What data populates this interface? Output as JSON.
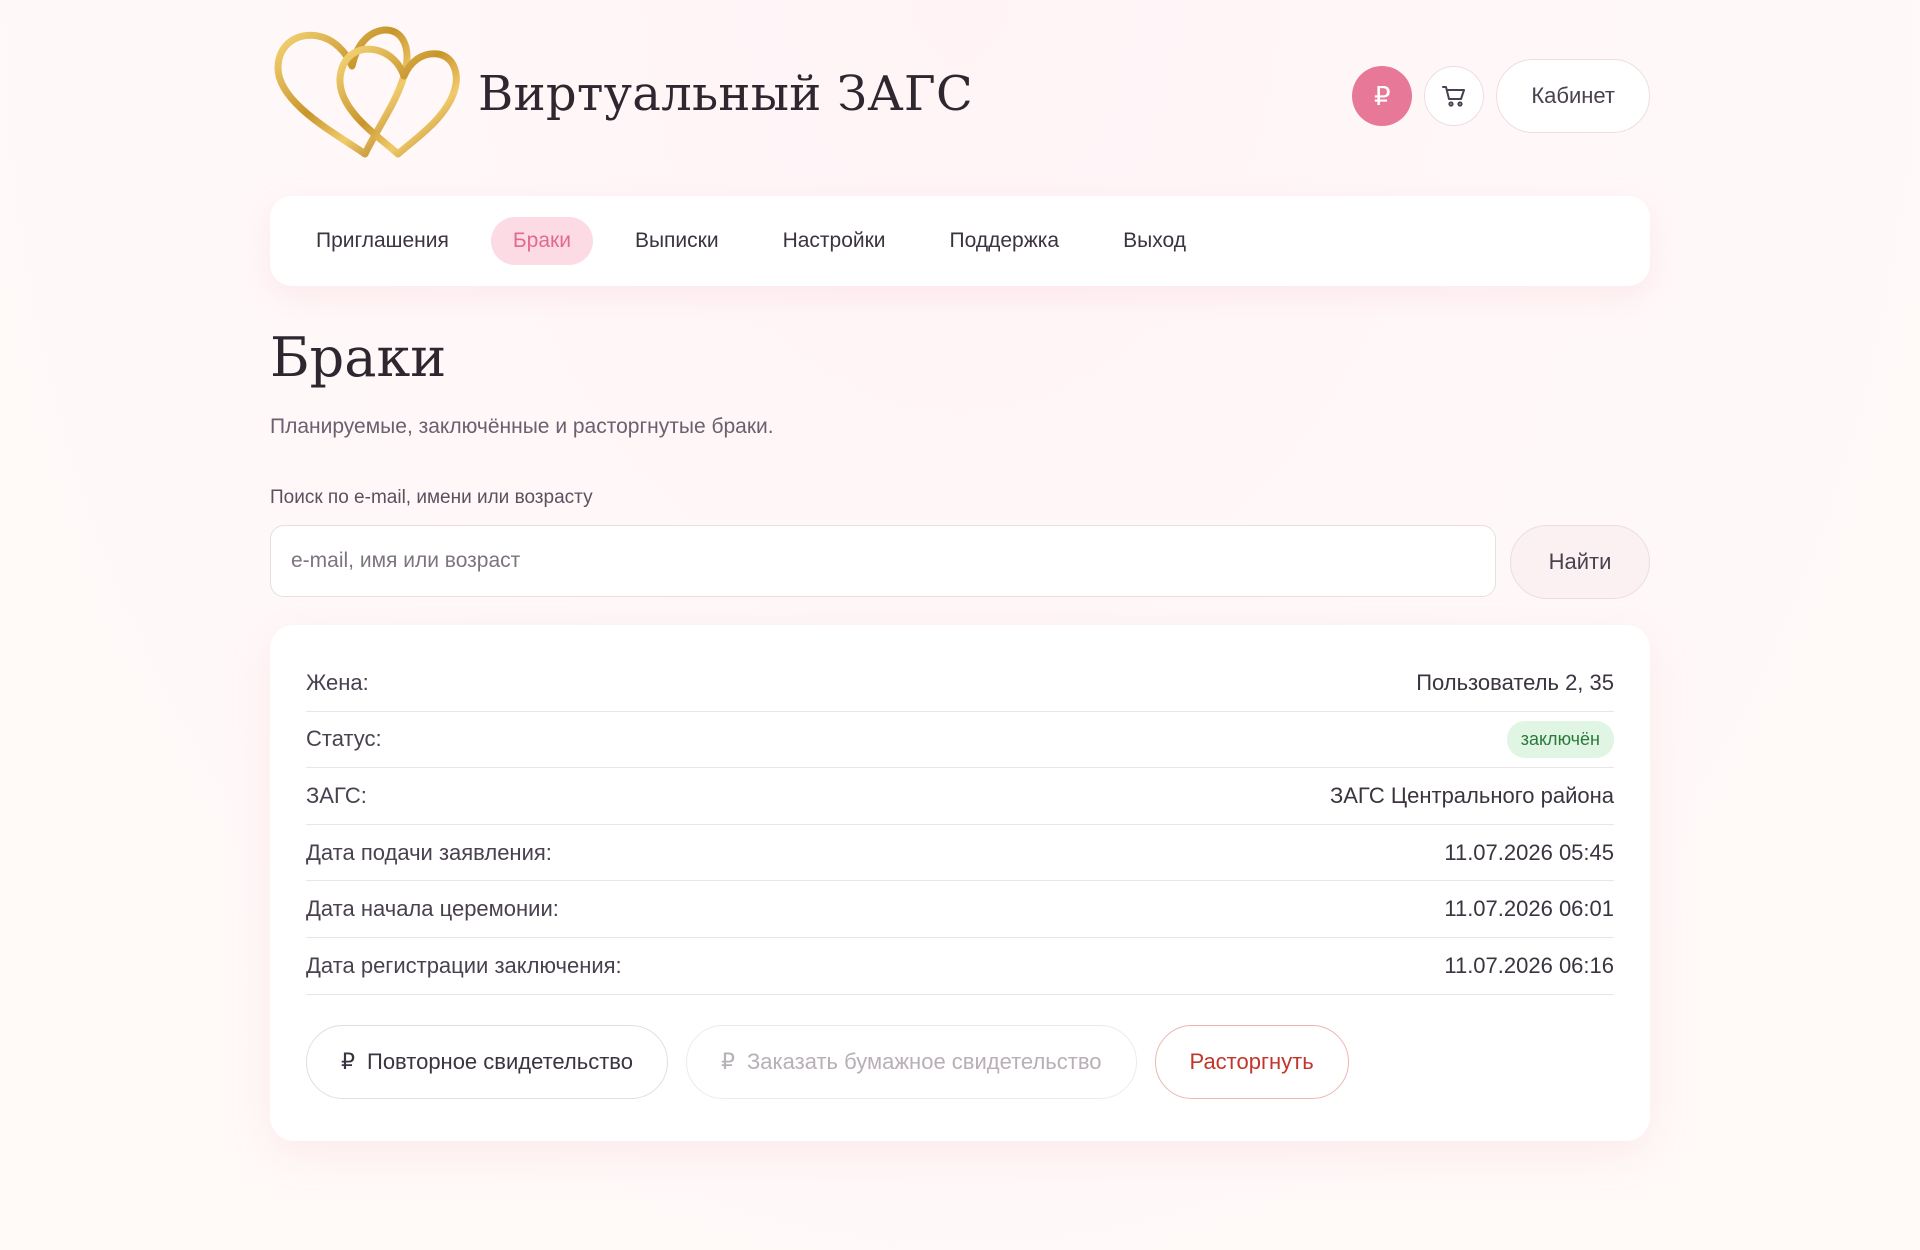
{
  "header": {
    "site_title": "Виртуальный ЗАГС",
    "balance_icon_glyph": "₽",
    "cabinet_label": "Кабинет"
  },
  "nav": {
    "items": [
      {
        "label": "Приглашения",
        "active": false
      },
      {
        "label": "Браки",
        "active": true
      },
      {
        "label": "Выписки",
        "active": false
      },
      {
        "label": "Настройки",
        "active": false
      },
      {
        "label": "Поддержка",
        "active": false
      },
      {
        "label": "Выход",
        "active": false
      }
    ]
  },
  "page": {
    "title": "Браки",
    "subtitle": "Планируемые, заключённые и расторгнутые браки."
  },
  "search": {
    "label": "Поиск по e-mail, имени или возрасту",
    "placeholder": "e-mail, имя или возраст",
    "value": "",
    "button_label": "Найти"
  },
  "marriage": {
    "rows": [
      {
        "label": "Жена:",
        "value": "Пользователь 2, 35"
      },
      {
        "label": "Статус:",
        "value": "заключён",
        "badge": true
      },
      {
        "label": "ЗАГС:",
        "value": "ЗАГС Центрального района"
      },
      {
        "label": "Дата подачи заявления:",
        "value": "11.07.2026 05:45"
      },
      {
        "label": "Дата начала церемонии:",
        "value": "11.07.2026 06:01"
      },
      {
        "label": "Дата регистрации заключения:",
        "value": "11.07.2026 06:16"
      }
    ],
    "actions": {
      "rub_glyph": "₽",
      "reissue_label": "Повторное свидетельство",
      "paper_label": "Заказать бумажное свидетельство",
      "paper_disabled": true,
      "divorce_label": "Расторгнуть"
    }
  },
  "colors": {
    "accent": "#e87898",
    "nav_active_bg": "#fcdbe5",
    "nav_active_text": "#e26a90",
    "status_bg": "#e1f5e4",
    "status_text": "#2a7a3b",
    "danger": "#c2352b",
    "logo_gold": "#d4a83a"
  },
  "icons": {
    "logo": "two-gold-hearts-icon",
    "balance": "ruble-icon",
    "cart": "cart-icon"
  }
}
